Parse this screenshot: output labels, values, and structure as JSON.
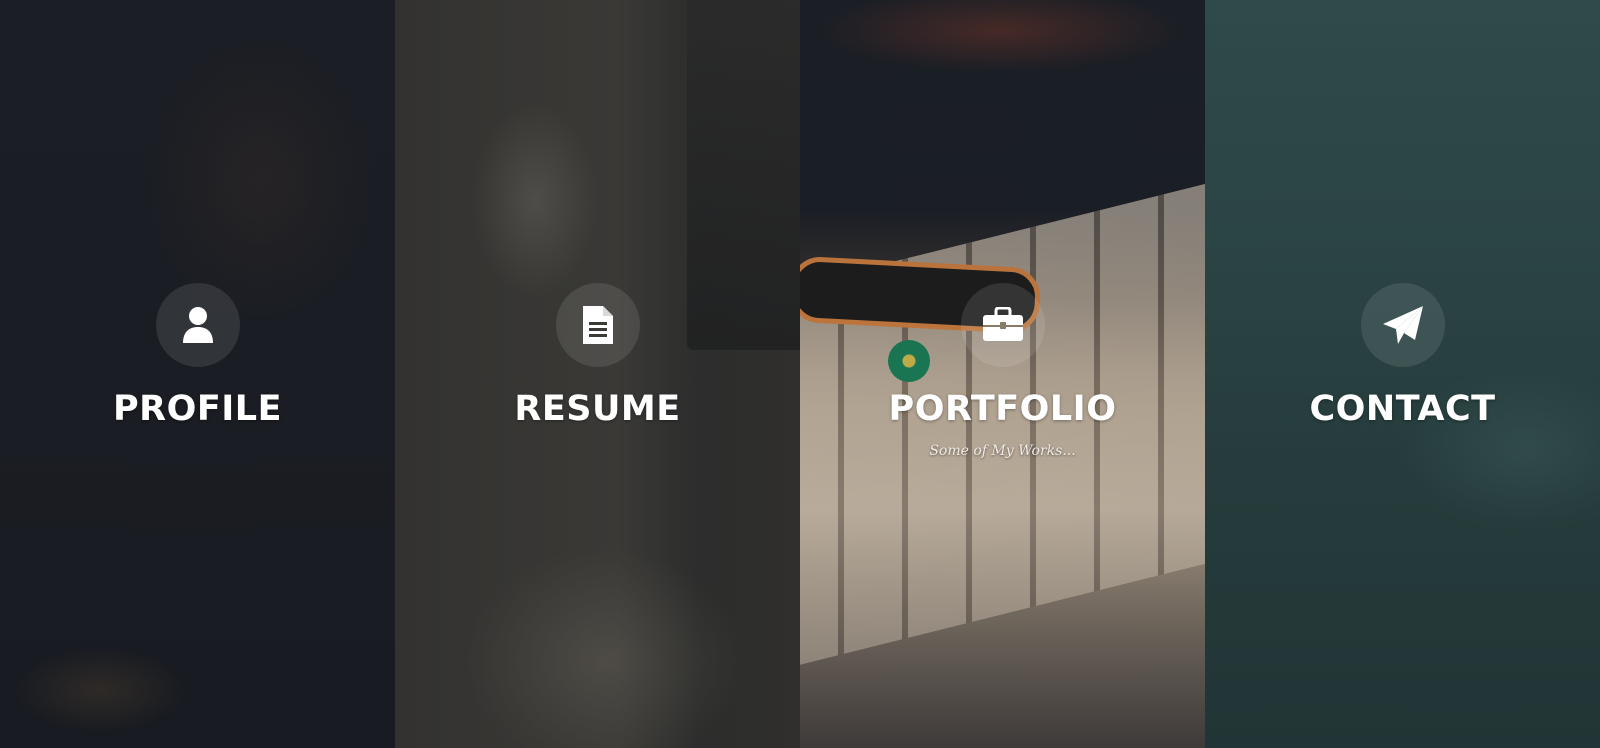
{
  "panels": [
    {
      "id": "profile",
      "title": "PROFILE",
      "icon": "user-icon",
      "subtitle": ""
    },
    {
      "id": "resume",
      "title": "RESUME",
      "icon": "document-icon",
      "subtitle": ""
    },
    {
      "id": "portfolio",
      "title": "PORTFOLIO",
      "icon": "briefcase-icon",
      "subtitle": "Some of My Works..."
    },
    {
      "id": "contact",
      "title": "CONTACT",
      "icon": "paper-plane-icon",
      "subtitle": ""
    }
  ],
  "colors": {
    "profile_bg": "#1a1d23",
    "resume_bg": "#363533",
    "portfolio_bg": "#8a7a68",
    "contact_bg": "#2a4242",
    "text": "#ffffff"
  }
}
